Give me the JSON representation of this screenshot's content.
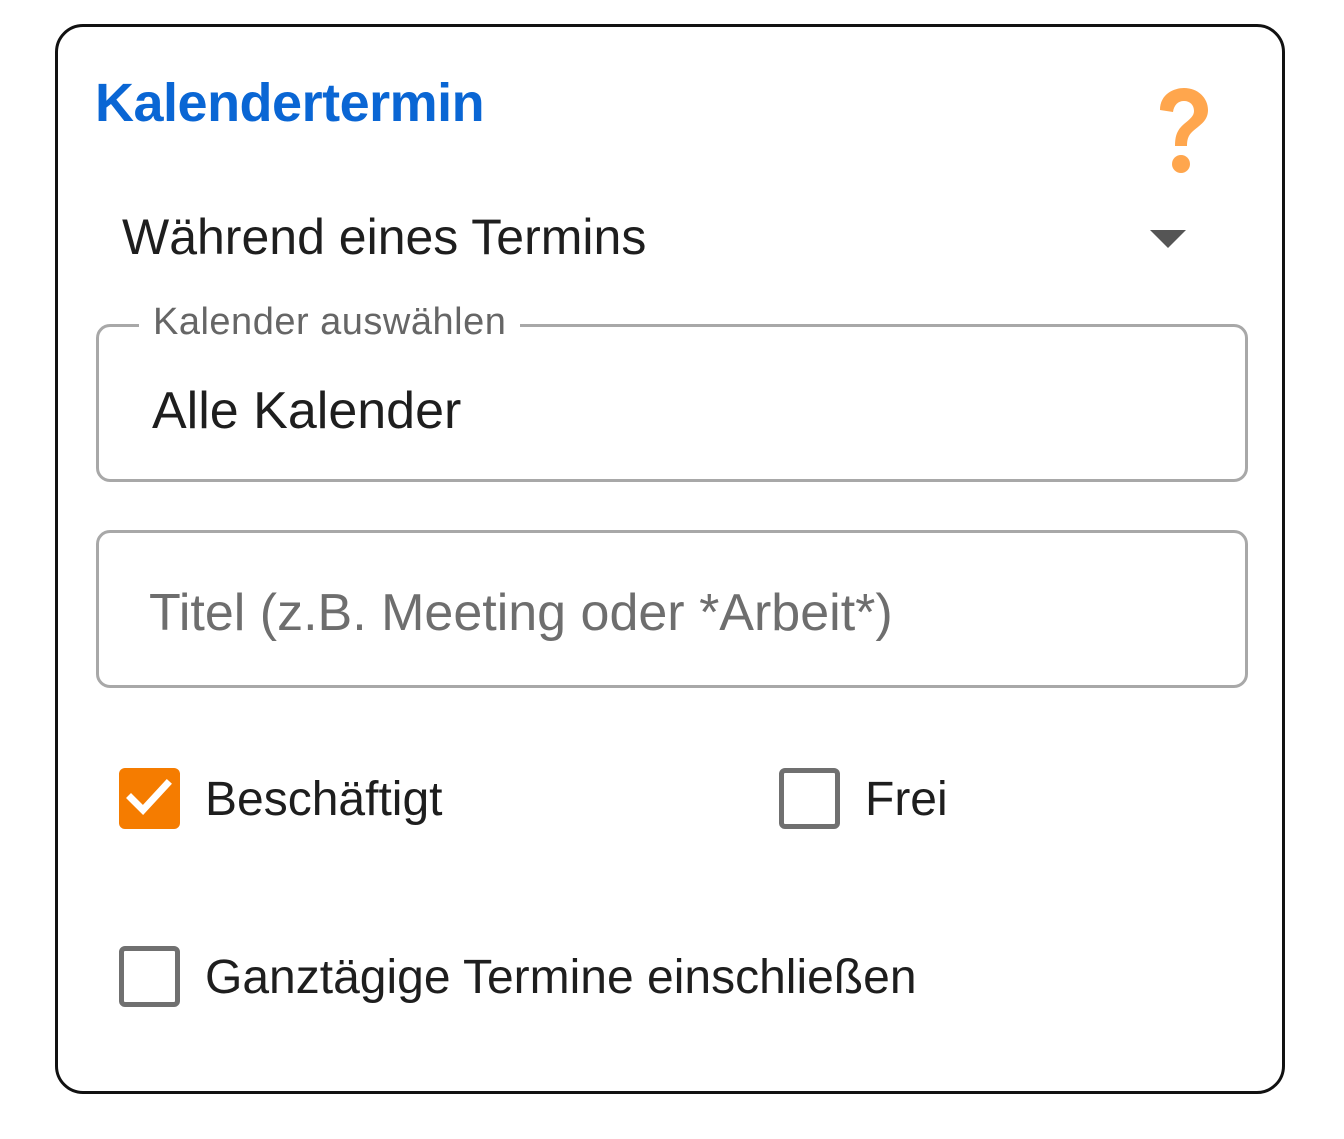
{
  "card": {
    "title": "Kalendertermin",
    "help_icon": "question-mark-icon",
    "accent_color": "#0a66d4",
    "help_color": "#ffa64d"
  },
  "trigger_select": {
    "selected": "Während eines Termins",
    "icon": "dropdown-arrow-icon"
  },
  "calendar_field": {
    "label": "Kalender auswählen",
    "value": "Alle Kalender"
  },
  "title_field": {
    "value": "",
    "placeholder": "Titel (z.B. Meeting oder *Arbeit*)"
  },
  "checkboxes": {
    "busy": {
      "label": "Beschäftigt",
      "checked": true,
      "color": "#f57c00"
    },
    "free": {
      "label": "Frei",
      "checked": false
    },
    "all_day": {
      "label": "Ganztägige Termine einschließen",
      "checked": false
    }
  }
}
